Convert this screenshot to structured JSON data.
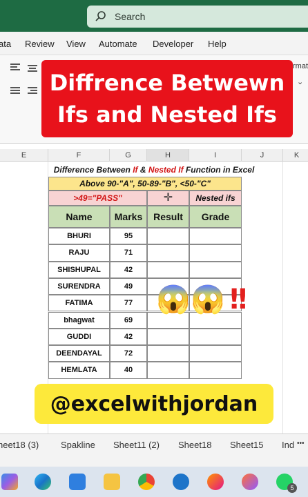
{
  "search": {
    "placeholder": "Search"
  },
  "menu": [
    "ata",
    "Review",
    "View",
    "Automate",
    "Developer",
    "Help"
  ],
  "ribbon": {
    "fragment": "rmat"
  },
  "banner": {
    "line1": "Diffrence Betwewn",
    "line2": "Ifs and Nested Ifs"
  },
  "columns": [
    "E",
    "F",
    "G",
    "H",
    "I",
    "J",
    "K"
  ],
  "caption": {
    "part1": "Difference Between ",
    "if": "If",
    "amp": " & ",
    "nested": "Nested If",
    "part2": " Function in Excel"
  },
  "table": {
    "criteria": "Above 90-\"A\", 50-89-\"B\", <50-\"C\"",
    "pass_rule": ">49=\"PASS\"",
    "nested_label": "Nested ifs",
    "headers": {
      "name": "Name",
      "marks": "Marks",
      "result": "Result",
      "grade": "Grade"
    },
    "rows": [
      {
        "name": "BHURI",
        "marks": "95"
      },
      {
        "name": "RAJU",
        "marks": "71"
      },
      {
        "name": "SHISHUPAL",
        "marks": "42"
      },
      {
        "name": "SURENDRA",
        "marks": "49"
      },
      {
        "name": "FATIMA",
        "marks": "77"
      },
      {
        "name": "bhagwat",
        "marks": "69"
      },
      {
        "name": "GUDDI",
        "marks": "42"
      },
      {
        "name": "DEENDAYAL",
        "marks": "72"
      },
      {
        "name": "HEMLATA",
        "marks": "40"
      }
    ]
  },
  "overlay": {
    "emoji1": "😱",
    "emoji2": "😱",
    "bang": "!!"
  },
  "handle": "@excelwithjordan",
  "tabs": [
    "heet18 (3)",
    "Spakline",
    "Sheet11 (2)",
    "Sheet18",
    "Sheet15",
    "Ind",
    "•••"
  ],
  "taskbar": {
    "icons": [
      "copilot-icon",
      "edge-icon",
      "store-icon",
      "file-explorer-icon",
      "chrome-icon",
      "app-icon",
      "firefox-icon",
      "firefox-dev-icon",
      "whatsapp-icon"
    ],
    "badge": "5"
  }
}
